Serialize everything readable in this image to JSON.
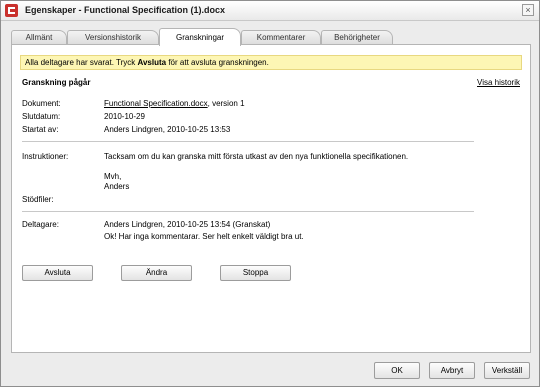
{
  "window": {
    "title": "Egenskaper - Functional Specification (1).docx",
    "close_glyph": "×"
  },
  "tabs": [
    {
      "label": "Allmänt"
    },
    {
      "label": "Versionshistorik"
    },
    {
      "label": "Granskningar"
    },
    {
      "label": "Kommentarer"
    },
    {
      "label": "Behörigheter"
    }
  ],
  "notice": {
    "prefix": "Alla deltagare har svarat. Tryck ",
    "bold": "Avsluta",
    "suffix": " för att avsluta granskningen."
  },
  "review": {
    "title": "Granskning pågår",
    "history_link": "Visa historik",
    "document_label": "Dokument:",
    "document_link": "Functional Specification.docx",
    "document_version": ", version 1",
    "end_date_label": "Slutdatum:",
    "end_date": "2010-10-29",
    "started_by_label": "Startat av:",
    "started_by": "Anders Lindgren, 2010-10-25 13:53",
    "instructions_label": "Instruktioner:",
    "instructions_line1": "Tacksam om du kan granska mitt första utkast av den nya funktionella specifikationen.",
    "instructions_line2": "Mvh,",
    "instructions_line3": "Anders",
    "support_files_label": "Stödfiler:",
    "participants_label": "Deltagare:",
    "participant": "Anders Lindgren, 2010-10-25 13:54 (Granskat)",
    "participant_comment": "Ok! Har inga kommentarar. Ser helt enkelt väldigt bra ut."
  },
  "actions": {
    "finish": "Avsluta",
    "change": "Ändra",
    "stop": "Stoppa"
  },
  "footer": {
    "ok": "OK",
    "cancel": "Avbryt",
    "apply": "Verkställ"
  },
  "colors": {
    "notice_bg": "#fdf6b4",
    "app_icon": "#c9302c"
  }
}
